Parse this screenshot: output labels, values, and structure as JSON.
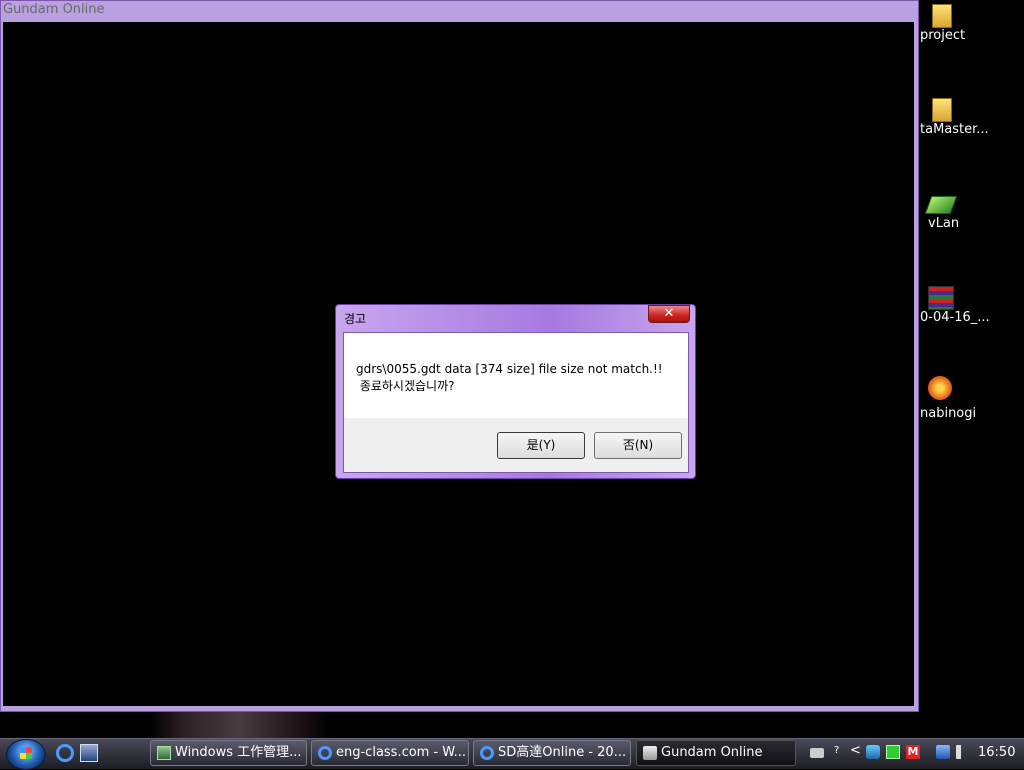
{
  "game_window": {
    "title": "Gundam Online"
  },
  "dialog": {
    "title": "경고",
    "close_glyph": "✕",
    "message": "gdrs\\0055.gdt data [374 size] file size not match.!!\n 종료하시겠습니까?",
    "yes_label": "是(Y)",
    "no_label": "否(N)"
  },
  "desktop_icons": [
    {
      "label": "project",
      "icon": "folder-icon"
    },
    {
      "label": "taMaster...",
      "icon": "folder-icon"
    },
    {
      "label": "vLan",
      "icon": "vlan-icon"
    },
    {
      "label": "0-04-16_...",
      "icon": "archive-icon"
    },
    {
      "label": "nabinogi",
      "icon": "mabinogi-icon"
    }
  ],
  "taskbar": {
    "tasks": [
      {
        "label": "Windows 工作管理...",
        "icon": "task-manager-icon"
      },
      {
        "label": "eng-class.com - W...",
        "icon": "ie-icon"
      },
      {
        "label": "SD高達Online - 20...",
        "icon": "ie-icon"
      },
      {
        "label": "Gundam Online",
        "icon": "gundam-icon",
        "active": true
      }
    ],
    "clock": "16:50",
    "tray_m": "M",
    "tray_chevron": "<"
  }
}
